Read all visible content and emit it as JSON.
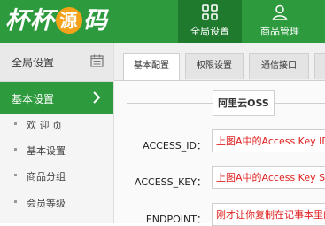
{
  "logo": {
    "text_a": "杯杯",
    "text_mid": "源",
    "text_b": "码"
  },
  "top_nav": [
    {
      "label": "全局设置",
      "icon": "grid-icon"
    },
    {
      "label": "商品管理",
      "icon": "user-icon"
    }
  ],
  "sidebar": {
    "header": "全局设置",
    "header_icon": "calendar-icon",
    "active_item": "基本设置",
    "sub_items": [
      "欢 迎 页",
      "基本设置",
      "商品分组",
      "会员等级"
    ]
  },
  "tabs": [
    "基本配置",
    "权限设置",
    "通信接口"
  ],
  "section_title": "阿里云OSS",
  "fields": [
    {
      "label": "ACCESS_ID：",
      "value": "上图A中的Access Key ID"
    },
    {
      "label": "ACCESS_KEY：",
      "value": "上图A中的Access Key Secret"
    },
    {
      "label": "ENDPOINT：",
      "value": "刚才让你复制在记事本里的"
    }
  ],
  "colors": {
    "brand_green": "#2e9a3e",
    "dark_green": "#1f7a2e",
    "logo_orange": "#f3a21a",
    "value_red": "#e02020"
  }
}
